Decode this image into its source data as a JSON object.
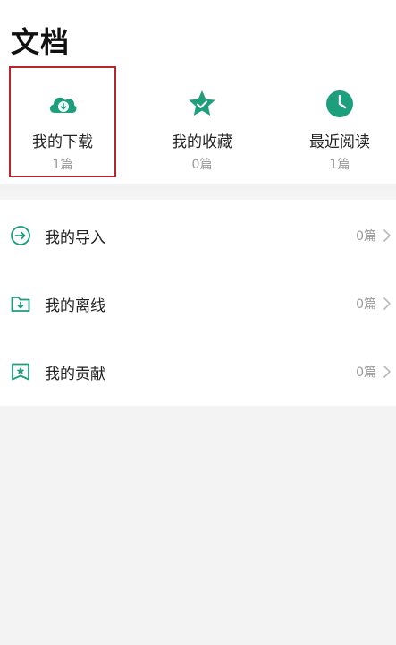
{
  "page": {
    "title": "文档"
  },
  "quick_actions": [
    {
      "label": "我的下载",
      "count": "1篇",
      "icon": "cloud-download-icon"
    },
    {
      "label": "我的收藏",
      "count": "0篇",
      "icon": "star-icon"
    },
    {
      "label": "最近阅读",
      "count": "1篇",
      "icon": "clock-icon"
    }
  ],
  "list_items": [
    {
      "label": "我的导入",
      "count": "0篇",
      "icon": "import-icon"
    },
    {
      "label": "我的离线",
      "count": "0篇",
      "icon": "offline-folder-icon"
    },
    {
      "label": "我的贡献",
      "count": "0篇",
      "icon": "contribution-icon"
    }
  ],
  "colors": {
    "accent": "#1d9f7e",
    "highlight_border": "#b3282e",
    "muted_text": "#999999"
  }
}
